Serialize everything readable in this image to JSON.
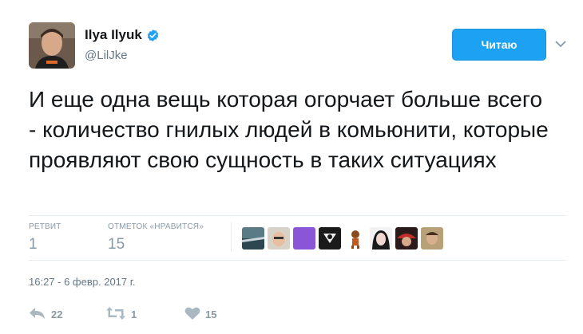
{
  "author": {
    "name": "Ilya Ilyuk",
    "handle": "@LilJke",
    "verified": true
  },
  "follow_button": {
    "label": "Читаю"
  },
  "tweet": {
    "text": "И еще одна вещь которая огорчает больше всего - количество гнилых людей в комьюнити, которые проявляют свою сущность в таких ситуациях"
  },
  "stats": {
    "retweets": {
      "label": "РЕТВИТ",
      "value": "1"
    },
    "likes": {
      "label": "ОТМЕТОК «НРАВИТСЯ»",
      "value": "15"
    }
  },
  "likers": [
    "liker-1",
    "liker-2",
    "liker-3",
    "liker-4",
    "liker-5",
    "liker-6",
    "liker-7",
    "liker-8",
    "liker-9"
  ],
  "timestamp": "16:27 - 6 февр. 2017 г.",
  "actions": {
    "reply": {
      "icon": "reply-icon",
      "count": "22"
    },
    "retweet": {
      "icon": "retweet-icon",
      "count": "1"
    },
    "like": {
      "icon": "heart-icon",
      "count": "15"
    }
  },
  "colors": {
    "accent": "#1da1f2",
    "muted": "#657786",
    "light_muted": "#8899a6",
    "border": "#e6ecf0"
  }
}
